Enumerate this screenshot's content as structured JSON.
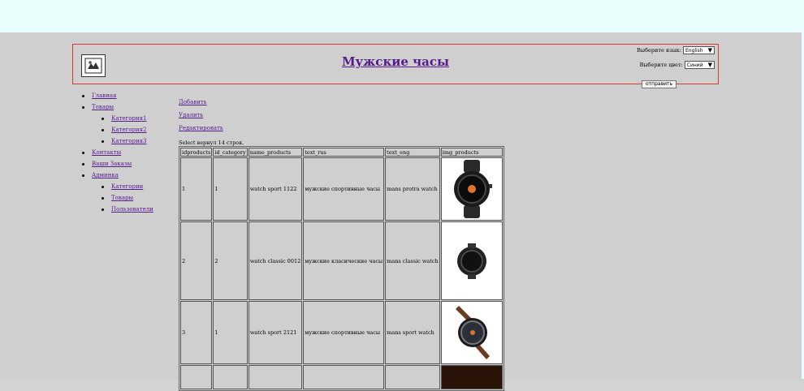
{
  "header": {
    "title": "Мужские часы",
    "language_label": "Выберите язык:",
    "language_value": "English",
    "color_label": "Выберите цвет:",
    "color_value": "Синий",
    "submit_label": "отправить"
  },
  "nav": {
    "home": "Главная",
    "products": "Товары",
    "categories": [
      "Категория1",
      "Категория2",
      "Категория3"
    ],
    "contacts": "Контакты",
    "orders": "Ваши Заказы",
    "admin": "Админка",
    "admin_items": [
      "Категории",
      "Товары",
      "Пользователи"
    ]
  },
  "actions": {
    "add": "Добавить",
    "delete": "Удалить",
    "edit": "Редактировать"
  },
  "result_text": "Select вернул 14 строк.",
  "table": {
    "headers": [
      "idproducts",
      "id_category",
      "name_products",
      "text_rus",
      "text_eng",
      "img_products"
    ],
    "rows": [
      [
        "1",
        "1",
        "watch sport 1122",
        "мужские спортивные часы",
        "mans protra watch"
      ],
      [
        "2",
        "2",
        "watch classic 0012",
        "мужские класические часы",
        "mans classic watch"
      ],
      [
        "3",
        "1",
        "watch sport 2121",
        "мужские спортивные часы",
        "mans sport watch"
      ]
    ]
  },
  "colors": {
    "link": "#551a8b",
    "header_border": "#d23a3a",
    "background": "#cfcfcf",
    "top_band": "#e9fdfd"
  },
  "icons": [
    "logo-icon",
    "chevron-down-icon",
    "watch-image"
  ]
}
